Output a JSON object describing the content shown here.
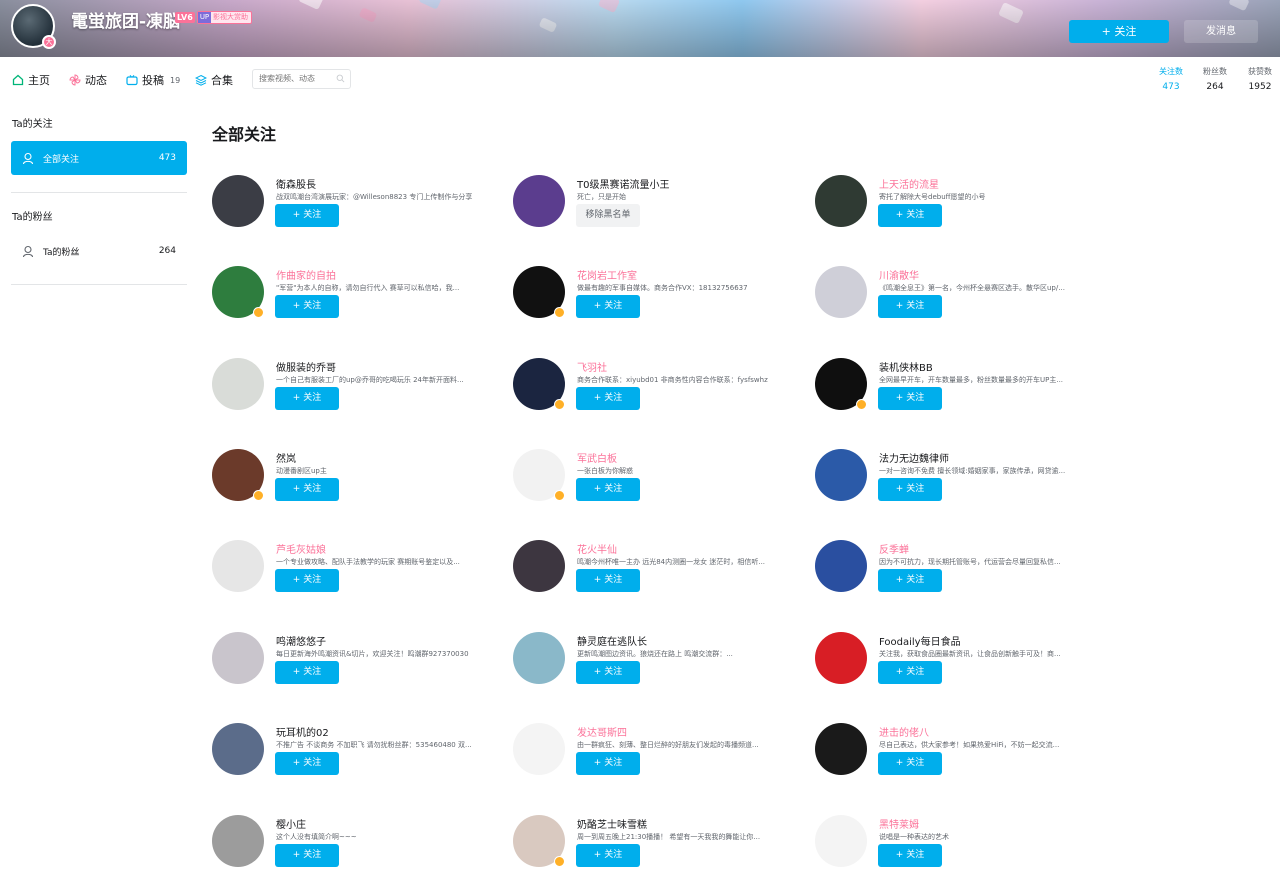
{
  "header": {
    "username": "電蛍旅团-凍脳",
    "level": "LV6",
    "medal_icon": "UP",
    "medal_text": "影视大赏助",
    "avatar_badge": "大",
    "follow_button": "+ 关注",
    "message_button": "发消息"
  },
  "nav": {
    "home": "主页",
    "dynamic": "动态",
    "uploads": "投稿",
    "uploads_count": "19",
    "collections": "合集",
    "search_placeholder": "搜索视频、动态"
  },
  "stats": [
    {
      "label": "关注数",
      "value": "473"
    },
    {
      "label": "粉丝数",
      "value": "264"
    },
    {
      "label": "获赞数",
      "value": "1952"
    }
  ],
  "sidebar": {
    "following_header": "Ta的关注",
    "following_item": "全部关注",
    "following_count": "473",
    "fans_header": "Ta的粉丝",
    "fans_item": "Ta的粉丝",
    "fans_count": "264"
  },
  "content": {
    "title": "全部关注",
    "follow_label": "+ 关注",
    "unblock_label": "移除黑名单"
  },
  "cards": [
    {
      "name": "衛森股長",
      "sign": "战双鸣潮台湾演展玩家：@Willeson8823 专门上传制作与分享",
      "vip": false,
      "badge": false,
      "btn": "+ 关注",
      "gray": false
    },
    {
      "name": "T0级黑赛诺流量小王",
      "sign": "死亡，只是开始",
      "vip": false,
      "badge": false,
      "btn": "移除黑名单",
      "gray": true
    },
    {
      "name": "上天活的流星",
      "sign": "寄托了解除大号debuff愿望的小号",
      "vip": true,
      "badge": false,
      "btn": "+ 关注",
      "gray": false
    },
    {
      "name": "作曲家的自拍",
      "sign": "\"军营\"为本人的自称，请勿自行代入 赛草可以私信哈，我...",
      "vip": true,
      "badge": true,
      "btn": "+ 关注",
      "gray": false
    },
    {
      "name": "花岗岩工作室",
      "sign": "做最有趣的军事自媒体。商务合作VX：18132756637",
      "vip": true,
      "badge": true,
      "btn": "+ 关注",
      "gray": false
    },
    {
      "name": "川渝散华",
      "sign": "《鸣潮全息王》第一名，今州杯全悬赛区选手。散华区up/...",
      "vip": true,
      "badge": false,
      "btn": "+ 关注",
      "gray": false
    },
    {
      "name": "做服装的乔哥",
      "sign": "一个自己有服装工厂的up@乔哥的吃喝玩乐 24年新开面料...",
      "vip": false,
      "badge": false,
      "btn": "+ 关注",
      "gray": false
    },
    {
      "name": "飞羽社",
      "sign": "商务合作联系：xiyubd01 非商务性内容合作联系：fysfswhz",
      "vip": true,
      "badge": true,
      "btn": "+ 关注",
      "gray": false
    },
    {
      "name": "装机侠林BB",
      "sign": "全网最早开车，开车数量最多，粉丝数量最多的开车UP主...",
      "vip": false,
      "badge": true,
      "btn": "+ 关注",
      "gray": false
    },
    {
      "name": "然岚",
      "sign": "动漫番剧区up主",
      "vip": false,
      "badge": true,
      "btn": "+ 关注",
      "gray": false
    },
    {
      "name": "军武白板",
      "sign": "一张白板为你解惑",
      "vip": true,
      "badge": true,
      "btn": "+ 关注",
      "gray": false
    },
    {
      "name": "法力无边魏律师",
      "sign": "一对一咨询不免费 擅长领域:婚姻家事，家族传承，网贷逾...",
      "vip": false,
      "badge": false,
      "btn": "+ 关注",
      "gray": false
    },
    {
      "name": "芦毛灰姑娘",
      "sign": "一个专业做攻略、配队手法教学的玩家 赛期账号鉴定以及...",
      "vip": true,
      "badge": false,
      "btn": "+ 关注",
      "gray": false
    },
    {
      "name": "花火半仙",
      "sign": "鸣潮今州杯唯一主办 远光84内测圈一龙女 迷茫时，相信听...",
      "vip": true,
      "badge": false,
      "btn": "+ 关注",
      "gray": false
    },
    {
      "name": "反季蝉",
      "sign": "因为不可抗力，现长期托管账号，代运营会尽量回复私信...",
      "vip": true,
      "badge": false,
      "btn": "+ 关注",
      "gray": false
    },
    {
      "name": "鸣潮悠悠子",
      "sign": "每日更新海外鸣潮资讯&切片，欢迎关注！鸣潮群927370030",
      "vip": false,
      "badge": false,
      "btn": "+ 关注",
      "gray": false
    },
    {
      "name": "静灵庭在逃队长",
      "sign": "更新鸣潮图边资讯。狼烧还在路上 鸣潮交流群：...",
      "vip": false,
      "badge": false,
      "btn": "+ 关注",
      "gray": false
    },
    {
      "name": "Foodaily每日食品",
      "sign": "关注我，获取食品圈最新资讯，让食品创新触手可及！商...",
      "vip": false,
      "badge": false,
      "btn": "+ 关注",
      "gray": false
    },
    {
      "name": "玩耳机的02",
      "sign": "不推广告 不谈商务 不加职飞 请勿扰粉丝群：535460480 双...",
      "vip": false,
      "badge": false,
      "btn": "+ 关注",
      "gray": false
    },
    {
      "name": "发达哥斯四",
      "sign": "由一群疯狂、刻薄、整日烂醉的好朋友们发起的毒播频道...",
      "vip": true,
      "badge": false,
      "btn": "+ 关注",
      "gray": false
    },
    {
      "name": "进击的佬八",
      "sign": "尽自己表达，供大家参考！如果热爱HiFi，不妨一起交流...",
      "vip": true,
      "badge": false,
      "btn": "+ 关注",
      "gray": false
    },
    {
      "name": "樱小庄",
      "sign": "这个人没有填简介啊~~~",
      "vip": false,
      "badge": false,
      "btn": "+ 关注",
      "gray": false
    },
    {
      "name": "奶酪芝士味雪糕",
      "sign": "周一到周五晚上21:30播播！ 希望有一天我我的舞能让你...",
      "vip": false,
      "badge": true,
      "btn": "+ 关注",
      "gray": false
    },
    {
      "name": "黑特莱姆",
      "sign": "说唱是一种表达的艺术",
      "vip": true,
      "badge": false,
      "btn": "+ 关注",
      "gray": false
    }
  ],
  "avatar_icons": [
    "hooded-boy-icon",
    "purple-mech-icon",
    "dark-hair-girl-icon",
    "green-soldier-icon",
    "mountain-logo-icon",
    "white-hair-girl-icon",
    "cat-photo-icon",
    "wings-logo-icon",
    "pc-case-icon",
    "brown-hair-girl-icon",
    "sniper-logo-icon",
    "lawyer-photo-icon",
    "sketch-girl-icon",
    "dark-hair-boy-icon",
    "blue-sketch-icon",
    "silver-hair-girl-icon",
    "magazine-icon",
    "foodaily-logo-icon",
    "hat-girl-icon",
    "text-logo-icon",
    "triangle-logo-icon",
    "grey-anime-icon",
    "photo-girl-icon",
    "mic-man-icon"
  ],
  "avatar_colors": [
    "#3b3d45",
    "#5b3d8e",
    "#2f3a33",
    "#2e7d3e",
    "#111111",
    "#cfcfd8",
    "#d9dcd8",
    "#1b2540",
    "#0f0f0f",
    "#6b3a2a",
    "#f2f2f2",
    "#2b5aa8",
    "#e6e6e6",
    "#3d3640",
    "#2a4fa0",
    "#c9c5cc",
    "#8ab8c9",
    "#d81e25",
    "#5b6c8a",
    "#f4f4f4",
    "#1a1a1a",
    "#9c9c9c",
    "#d9c9c0",
    "#f4f4f4"
  ],
  "colors": {
    "accent": "#00aeec",
    "vip_name": "#fb7299"
  }
}
